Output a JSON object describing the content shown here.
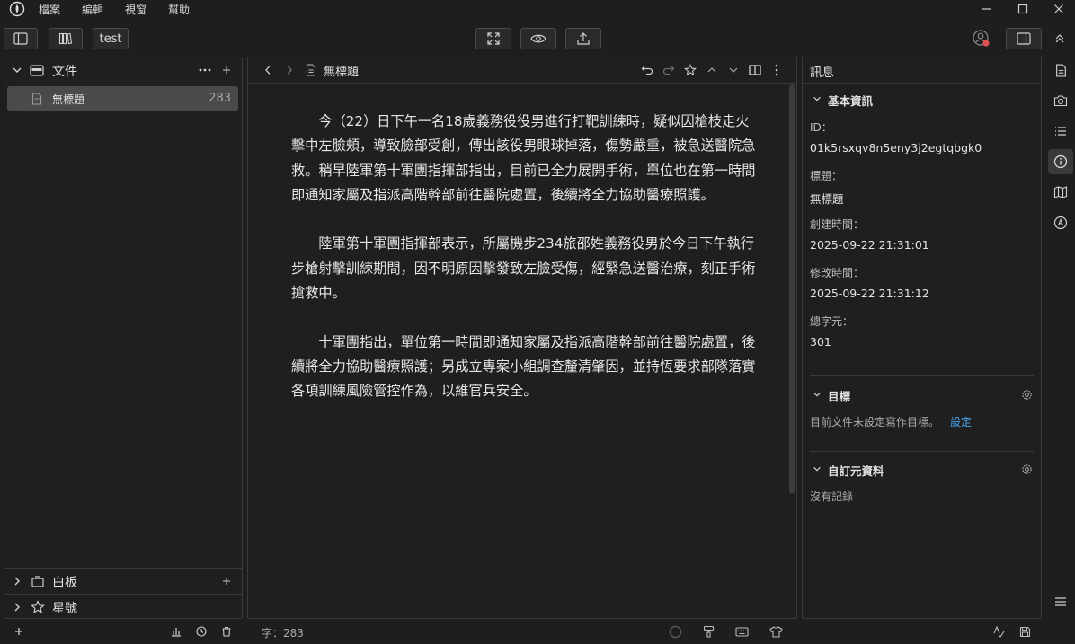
{
  "menubar": {
    "items": [
      "檔案",
      "編輯",
      "視窗",
      "幫助"
    ]
  },
  "toolbar": {
    "workspace_label": "test"
  },
  "sidebar": {
    "files_section": {
      "label": "文件"
    },
    "files": [
      {
        "name": "無標題",
        "count": "283"
      }
    ],
    "whiteboard_section": {
      "label": "白板"
    },
    "starred_section": {
      "label": "星號"
    }
  },
  "editor": {
    "doc_title": "無標題",
    "paragraphs": [
      "今（22）日下午一名18歲義務役役男進行打靶訓練時，疑似因槍枝走火擊中左臉頰，導致臉部受創，傳出該役男眼球掉落，傷勢嚴重，被急送醫院急救。稍早陸軍第十軍團指揮部指出，目前已全力展開手術，單位也在第一時間即通知家屬及指派高階幹部前往醫院處置，後續將全力協助醫療照護。",
      "陸軍第十軍團指揮部表示，所屬機步234旅邵姓義務役男於今日下午執行步槍射擊訓練期間，因不明原因擊發致左臉受傷，經緊急送醫治療，刻正手術搶救中。",
      "十軍團指出，單位第一時間即通知家屬及指派高階幹部前往醫院處置，後續將全力協助醫療照護；另成立專案小組調查釐清肇因，並持恆要求部隊落實各項訓練風險管控作為，以維官兵安全。"
    ]
  },
  "info": {
    "panel_title": "訊息",
    "basic_section": "基本資訊",
    "id_label": "ID：",
    "id_value": "01k5rsxqv8n5eny3j2egtqbgk0",
    "title_label": "標題：",
    "title_value": "無標題",
    "created_label": "創建時間：",
    "created_value": "2025-09-22 21:31:01",
    "modified_label": "修改時間：",
    "modified_value": "2025-09-22 21:31:12",
    "chars_label": "總字元：",
    "chars_value": "301",
    "goal_section": "目標",
    "goal_text": "目前文件未設定寫作目標。",
    "goal_link": "設定",
    "custom_section": "自訂元資料",
    "custom_empty": "沒有記錄"
  },
  "statusbar": {
    "word_count": "字：283"
  },
  "colors": {
    "background": "#1e1e1e",
    "pane": "#1f1f1f",
    "selected_row": "#4a4a4a",
    "link": "#4aa3e8",
    "avatar_badge": "#e05252"
  }
}
